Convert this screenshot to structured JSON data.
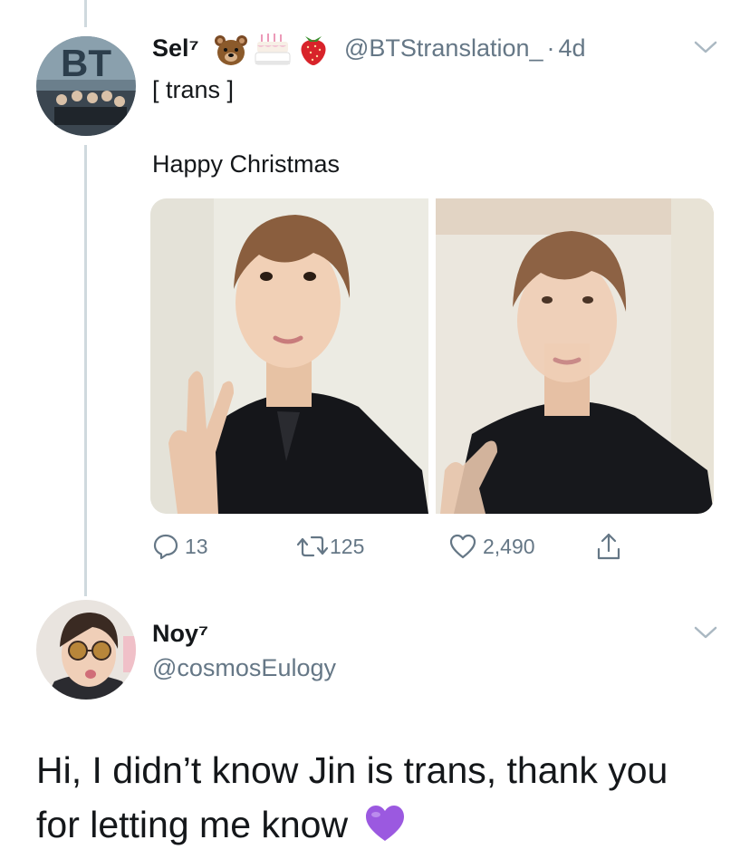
{
  "tweet": {
    "display_name": "Sel⁷",
    "name_emojis": [
      "bear-emoji",
      "birthday-cake-emoji",
      "strawberry-emoji"
    ],
    "handle": "@BTStranslation_",
    "separator": "·",
    "time": "4d",
    "subtitle": "[ trans ]",
    "avatar_text": "BT",
    "text": "Happy Christmas",
    "photos": [
      "selfie-peace-sign",
      "selfie-blurry"
    ],
    "actions": {
      "replies": "13",
      "retweets": "125",
      "likes": "2,490"
    }
  },
  "reply": {
    "display_name": "Noy⁷",
    "handle": "@cosmosEulogy",
    "text_line1": "Hi, I didn’t know Jin is trans, thank you",
    "text_line2": "for letting me know",
    "text_emoji": "purple-heart-emoji"
  },
  "colors": {
    "text": "#14171a",
    "secondary": "#657786",
    "thread_line": "#cfd9de",
    "purple_heart": "#9b59e0"
  }
}
